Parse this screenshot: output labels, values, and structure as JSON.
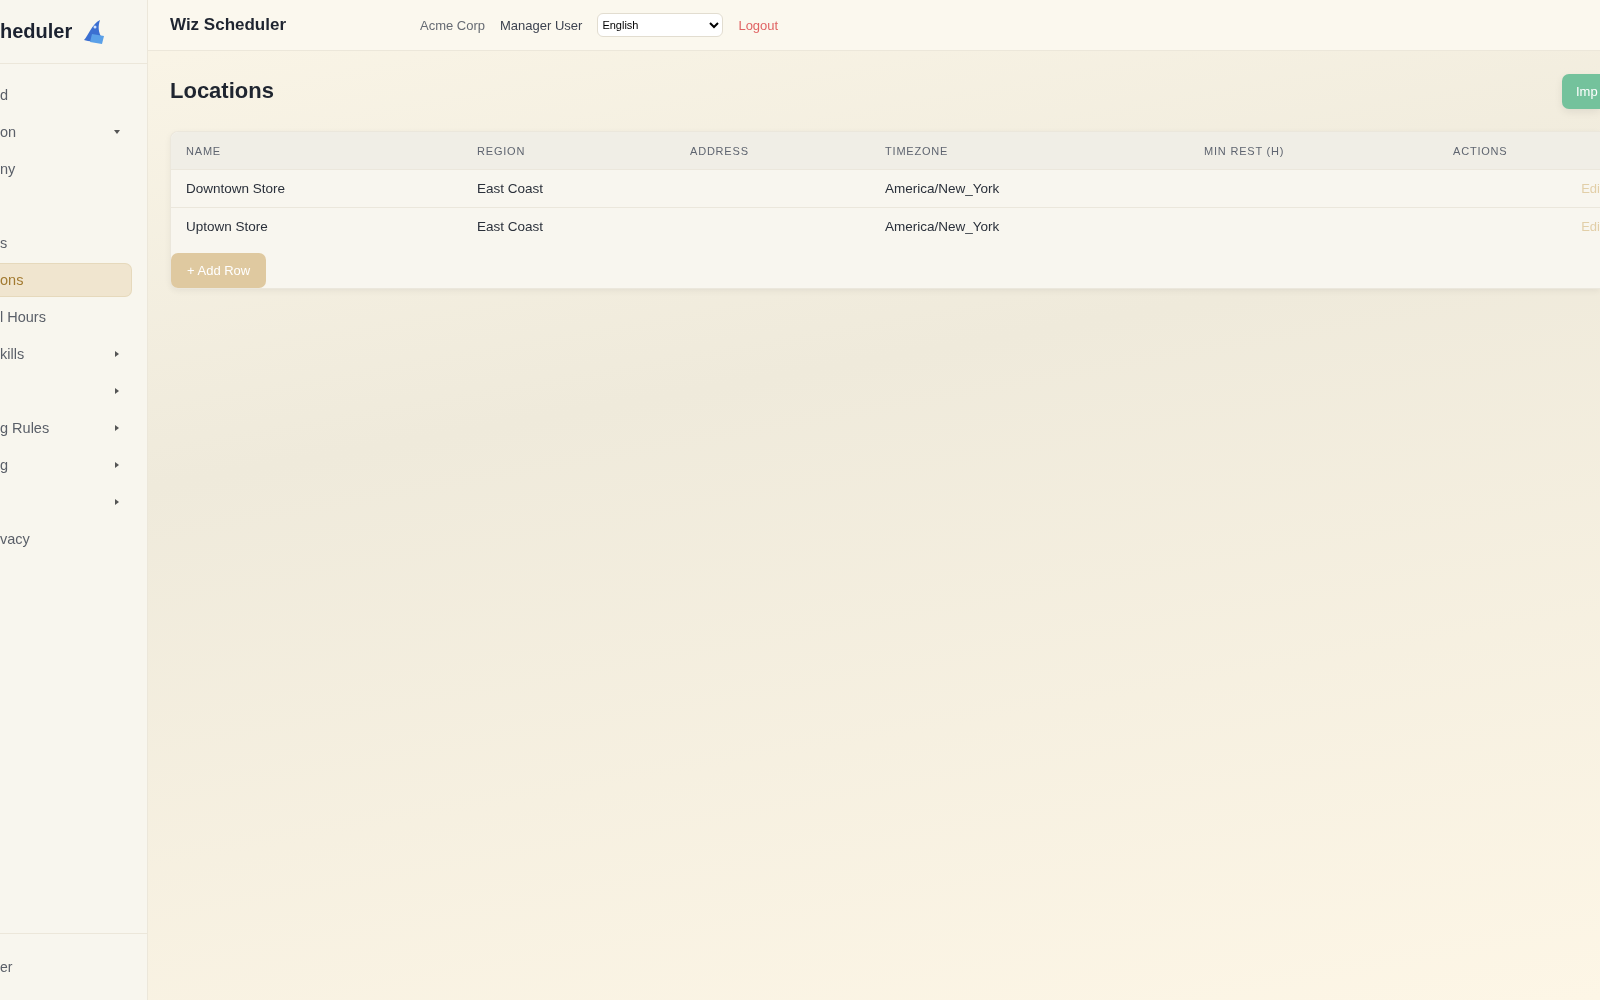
{
  "sidebar": {
    "brand": "heduler",
    "items": [
      {
        "label": "d",
        "selected": false
      },
      {
        "label": "on",
        "selected": false,
        "kind": "group",
        "expanded": true
      },
      {
        "label": "ny",
        "selected": false
      },
      {
        "kind": "blank"
      },
      {
        "label": "s",
        "selected": false
      },
      {
        "label": "ons",
        "selected": true
      },
      {
        "label": "l Hours",
        "selected": false
      },
      {
        "label": "kills",
        "selected": false,
        "kind": "group",
        "expanded": false
      },
      {
        "selected": false,
        "kind": "group",
        "expanded": false
      },
      {
        "label": "g Rules",
        "selected": false,
        "kind": "group",
        "expanded": false
      },
      {
        "label": "g",
        "selected": false,
        "kind": "group",
        "expanded": false
      },
      {
        "selected": false,
        "kind": "group",
        "expanded": false
      },
      {
        "label": "vacy",
        "selected": false
      }
    ],
    "footer": "er"
  },
  "header": {
    "title": "Wiz Scheduler",
    "company": "Acme Corp",
    "user": "Manager User",
    "language": "English",
    "logout": "Logout"
  },
  "page": {
    "title": "Locations",
    "import_button": "Imp"
  },
  "table": {
    "columns": [
      "NAME",
      "REGION",
      "ADDRESS",
      "TIMEZONE",
      "MIN REST (H)",
      "ACTIONS"
    ],
    "rows": [
      {
        "name": "Downtown Store",
        "region": "East Coast",
        "timezone": "America/New_York",
        "action": "Edi"
      },
      {
        "name": "Uptown Store",
        "region": "East Coast",
        "timezone": "America/New_York",
        "action": "Edi"
      }
    ],
    "add_button": "+ Add Row"
  }
}
